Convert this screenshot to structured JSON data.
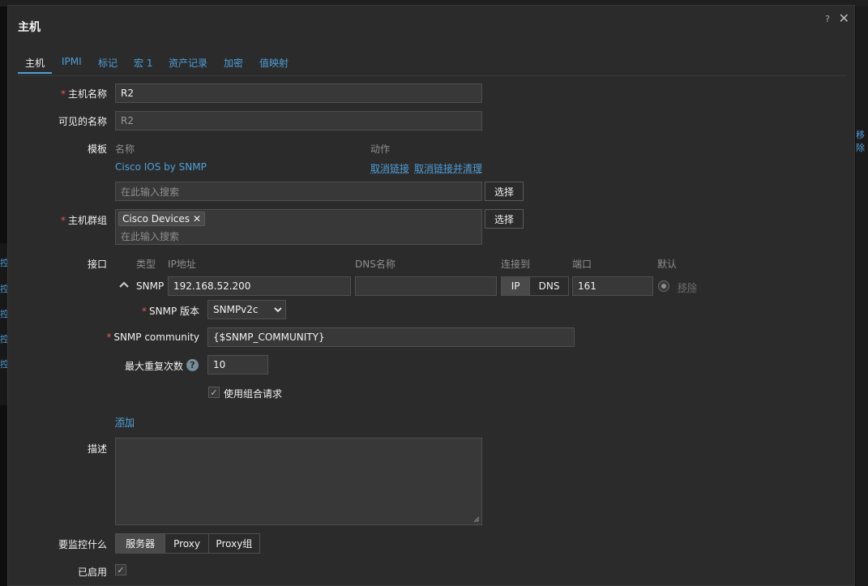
{
  "background": {
    "right_fragment": "移除",
    "left_fragments": [
      "控",
      "控",
      "控",
      "控",
      "控"
    ]
  },
  "modal": {
    "title": "主机",
    "help_symbol": "?",
    "close_symbol": "✕"
  },
  "tabs": [
    {
      "label": "主机",
      "active": true
    },
    {
      "label": "IPMI"
    },
    {
      "label": "标记"
    },
    {
      "label": "宏",
      "count": "1"
    },
    {
      "label": "资产记录"
    },
    {
      "label": "加密"
    },
    {
      "label": "值映射"
    }
  ],
  "form": {
    "host_name": {
      "label": "主机名称",
      "required": true,
      "value": "R2"
    },
    "visible_name": {
      "label": "可见的名称",
      "value": "",
      "placeholder": "R2"
    },
    "templates": {
      "label": "模板",
      "col_name": "名称",
      "col_action": "动作",
      "items": [
        {
          "name": "Cisco IOS by SNMP",
          "unlink": "取消链接",
          "unlink_clear": "取消链接并清理"
        }
      ],
      "search_placeholder": "在此输入搜索",
      "select_button": "选择"
    },
    "host_groups": {
      "label": "主机群组",
      "required": true,
      "chips": [
        "Cisco Devices"
      ],
      "search_placeholder": "在此输入搜索",
      "select_button": "选择"
    },
    "interfaces": {
      "label": "接口",
      "headers": {
        "type": "类型",
        "ip": "IP地址",
        "dns": "DNS名称",
        "connect": "连接到",
        "port": "端口",
        "default": "默认"
      },
      "rows": [
        {
          "type": "SNMP",
          "ip": "192.168.52.200",
          "dns": "",
          "connect_options": [
            "IP",
            "DNS"
          ],
          "connect_selected": "IP",
          "port": "161",
          "remove": "移除"
        }
      ],
      "snmp": {
        "version_label": "SNMP 版本",
        "version_value": "SNMPv2c",
        "community_label": "SNMP community",
        "community_value": "{$SNMP_COMMUNITY}",
        "max_repetitions_label": "最大重复次数",
        "max_repetitions_value": "10",
        "bulk_label": "使用组合请求",
        "bulk_checked": true
      },
      "add_link": "添加"
    },
    "description": {
      "label": "描述",
      "value": ""
    },
    "monitored_by": {
      "label": "要监控什么",
      "options": [
        "服务器",
        "Proxy",
        "Proxy组"
      ],
      "selected": "服务器"
    },
    "enabled": {
      "label": "已启用",
      "checked": true
    }
  }
}
